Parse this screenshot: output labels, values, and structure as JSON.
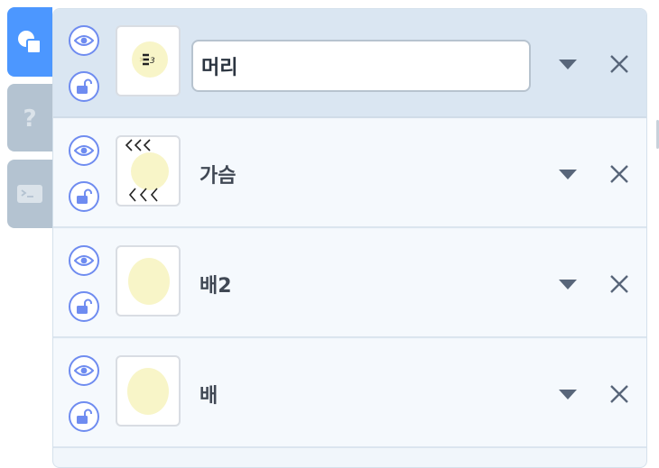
{
  "sidebar": {
    "tabs": [
      {
        "icon": "shapes-icon",
        "active": true
      },
      {
        "icon": "question-icon",
        "active": false
      },
      {
        "icon": "terminal-icon",
        "active": false
      }
    ]
  },
  "items": [
    {
      "name": "머리",
      "editing": true,
      "thumb": "head-thumbnail-icon"
    },
    {
      "name": "가슴",
      "editing": false,
      "thumb": "chest-thumbnail-icon"
    },
    {
      "name": "배2",
      "editing": false,
      "thumb": "belly-thumbnail-icon"
    },
    {
      "name": "배",
      "editing": false,
      "thumb": "belly-thumbnail-icon"
    }
  ],
  "colors": {
    "accent": "#4c97ff",
    "inactive_tab": "#b4c3d1",
    "icon_blue": "#6f8cf0",
    "selected_row": "#dae6f2",
    "thumb_fill": "#f8f5c8",
    "text": "#404854"
  }
}
